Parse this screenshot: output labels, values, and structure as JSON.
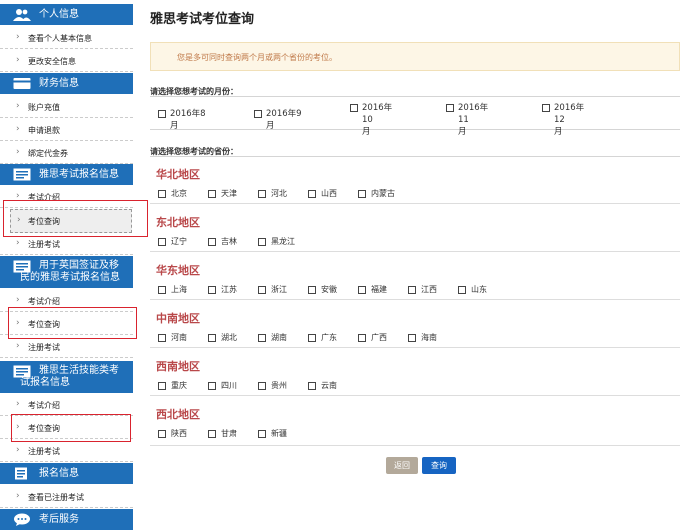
{
  "sidebar": {
    "sections": [
      {
        "title": "个人信息",
        "items": [
          "查看个人基本信息",
          "更改安全信息"
        ]
      },
      {
        "title": "财务信息",
        "items": [
          "账户充值",
          "申请退款",
          "绑定代金券"
        ]
      },
      {
        "title": "雅思考试报名信息",
        "items": [
          "考试介绍",
          "考位查询",
          "注册考试"
        ]
      },
      {
        "title_line1": "用于英国签证及移",
        "title_line2": "民的雅思考试报名信息",
        "items": [
          "考试介绍",
          "考位查询",
          "注册考试"
        ]
      },
      {
        "title_line1": "雅思生活技能类考",
        "title_line2": "试报名信息",
        "items": [
          "考试介绍",
          "考位查询",
          "注册考试"
        ]
      },
      {
        "title": "报名信息",
        "items": [
          "查看已注册考试"
        ]
      },
      {
        "title": "考后服务"
      }
    ]
  },
  "main": {
    "title": "雅思考试考位查询",
    "notice": "您是多可同时查询两个月或两个省份的考位。",
    "month_question": "请选择您想考试的月份：",
    "months": [
      {
        "line1": "2016年8月",
        "line2": ""
      },
      {
        "line1": "2016年9月",
        "line2": ""
      },
      {
        "line1": "2016年10",
        "line2": "月"
      },
      {
        "line1": "2016年11",
        "line2": "月"
      },
      {
        "line1": "2016年12",
        "line2": "月"
      }
    ],
    "province_question": "请选择您想考试的省份：",
    "regions": [
      {
        "name": "华北地区",
        "provinces": [
          "北京",
          "天津",
          "河北",
          "山西",
          "内蒙古"
        ]
      },
      {
        "name": "东北地区",
        "provinces": [
          "辽宁",
          "吉林",
          "黑龙江"
        ]
      },
      {
        "name": "华东地区",
        "provinces": [
          "上海",
          "江苏",
          "浙江",
          "安徽",
          "福建",
          "江西",
          "山东"
        ]
      },
      {
        "name": "中南地区",
        "provinces": [
          "河南",
          "湖北",
          "湖南",
          "广东",
          "广西",
          "海南"
        ]
      },
      {
        "name": "西南地区",
        "provinces": [
          "重庆",
          "四川",
          "贵州",
          "云南"
        ]
      },
      {
        "name": "西北地区",
        "provinces": [
          "陕西",
          "甘肃",
          "新疆"
        ]
      }
    ],
    "back_label": "返回",
    "query_label": "查询"
  },
  "colors": {
    "sidebar_header": "#1f6fb8",
    "region_title": "#b9484a",
    "highlight_box": "#d9232e",
    "query_button": "#1664c2",
    "back_button": "#b3a99a"
  },
  "icons": [
    "user-icon",
    "card-icon",
    "form-icon",
    "form-icon",
    "form-icon",
    "list-icon",
    "chat-icon"
  ]
}
